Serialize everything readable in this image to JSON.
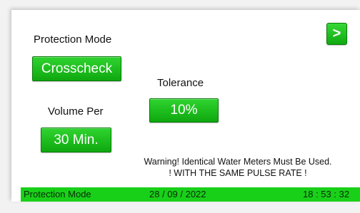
{
  "next_button": {
    "label": ">"
  },
  "protection_mode": {
    "label": "Protection Mode",
    "value": "Crosscheck"
  },
  "tolerance": {
    "label": "Tolerance",
    "value": "10%"
  },
  "volume_per": {
    "label": "Volume Per",
    "value": "30 Min."
  },
  "warning": {
    "line1": "Warning! Identical Water Meters Must Be Used.",
    "line2": "! WITH THE SAME PULSE RATE !"
  },
  "status_bar": {
    "screen": "Protection Mode",
    "date": "28 / 09 / 2022",
    "time": "18 : 53 : 32"
  },
  "colors": {
    "button_green": "#1cbc1c",
    "status_green": "#19d019",
    "background": "#ffffff"
  }
}
